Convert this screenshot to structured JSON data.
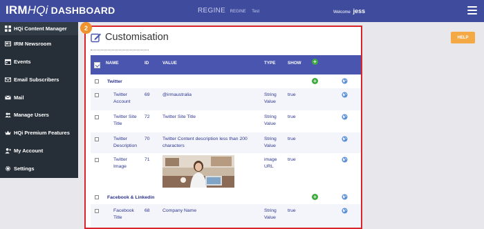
{
  "header": {
    "logo_main": "IRM",
    "logo_hqi": "HQi",
    "logo_dash": "DASHBOARD",
    "client_name": "REGINE",
    "client_code": "REGINE",
    "env": "Test",
    "welcome": "Welcome",
    "user": "jess"
  },
  "sidebar": {
    "items": [
      {
        "label": "HQi Content Manager",
        "icon": "grid-icon"
      },
      {
        "label": "IRM Newsroom",
        "icon": "newspaper-icon"
      },
      {
        "label": "Events",
        "icon": "calendar-icon"
      },
      {
        "label": "Email Subscribers",
        "icon": "envelope-icon"
      },
      {
        "label": "Mail",
        "icon": "mail-icon"
      },
      {
        "label": "Manage Users",
        "icon": "users-icon"
      },
      {
        "label": "HQi Premium Features",
        "icon": "crown-icon"
      },
      {
        "label": "My Account",
        "icon": "user-plus-icon"
      },
      {
        "label": "Settings",
        "icon": "gear-icon"
      }
    ]
  },
  "badge": "2",
  "help_label": "HELP",
  "page_title": "Customisation",
  "table": {
    "headers": {
      "name": "NAME",
      "id": "ID",
      "value": "VALUE",
      "type": "TYPE",
      "show": "SHOW"
    },
    "groups": [
      {
        "name": "Twitter",
        "rows": [
          {
            "name": "Twitter Account",
            "id": "69",
            "value": "@irmaustralia",
            "type": "String Value",
            "show": "true"
          },
          {
            "name": "Twitter Site Title",
            "id": "72",
            "value": "Twitter Site Title",
            "type": "String Value",
            "show": "true"
          },
          {
            "name": "Twitter Description",
            "id": "70",
            "value": "Twitter Content description less than 200 characters",
            "type": "String Value",
            "show": "true"
          },
          {
            "name": "Twitter Image",
            "id": "71",
            "value": "",
            "type": "image URL",
            "show": "true"
          }
        ]
      },
      {
        "name": "Facebook & Linkedin",
        "rows": [
          {
            "name": "Facebook Title",
            "id": "68",
            "value": "Company Name",
            "type": "String Value",
            "show": "true"
          }
        ]
      }
    ]
  },
  "colors": {
    "topbar": "#3f4b9c",
    "sidebar": "#262f38",
    "accent_red": "#d9232a",
    "help": "#f5a945",
    "badge": "#f0922e",
    "table_header": "#4a55b0"
  }
}
